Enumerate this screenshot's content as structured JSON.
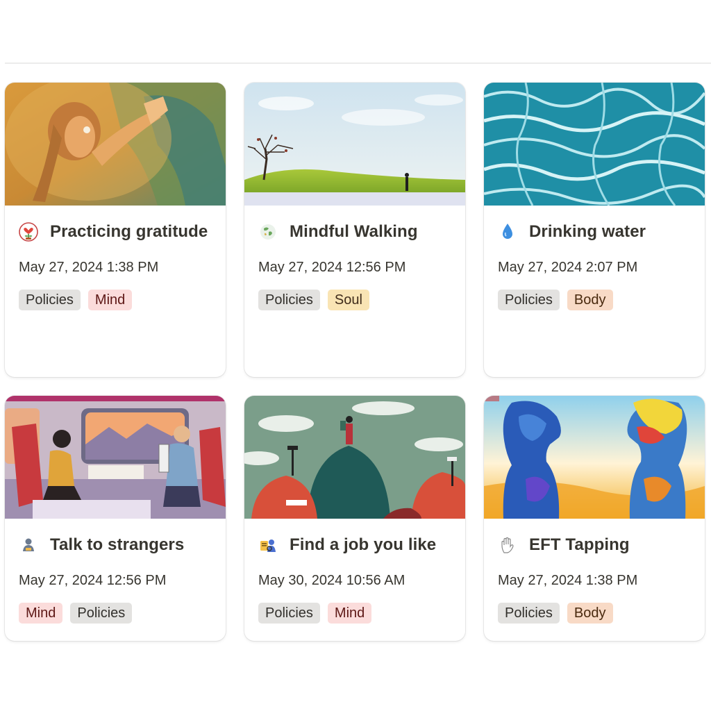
{
  "cards": [
    {
      "title": "Practicing gratitude",
      "date": "May 27, 2024 1:38 PM",
      "icon": "heart-plant-icon",
      "cover": "woman-praying-painting",
      "tags": [
        {
          "label": "Policies",
          "bg": "#e3e2e0",
          "fg": "#32302c"
        },
        {
          "label": "Mind",
          "bg": "#fbdcdb",
          "fg": "#5d1715"
        }
      ]
    },
    {
      "title": "Mindful Walking",
      "date": "May 27, 2024 12:56 PM",
      "icon": "earth-icon",
      "cover": "tree-on-green-hill",
      "tags": [
        {
          "label": "Policies",
          "bg": "#e3e2e0",
          "fg": "#32302c"
        },
        {
          "label": "Soul",
          "bg": "#f9e4b4",
          "fg": "#402c1b"
        }
      ]
    },
    {
      "title": "Drinking water",
      "date": "May 27, 2024 2:07 PM",
      "icon": "water-drop-icon",
      "cover": "pool-water-ripples",
      "tags": [
        {
          "label": "Policies",
          "bg": "#e3e2e0",
          "fg": "#32302c"
        },
        {
          "label": "Body",
          "bg": "#f8dac6",
          "fg": "#49290e"
        }
      ]
    },
    {
      "title": "Talk to strangers",
      "date": "May 27, 2024 12:56 PM",
      "icon": "people-icon",
      "cover": "train-passengers-illustration",
      "tags": [
        {
          "label": "Mind",
          "bg": "#fbdcdb",
          "fg": "#5d1715"
        },
        {
          "label": "Policies",
          "bg": "#e3e2e0",
          "fg": "#32302c"
        }
      ]
    },
    {
      "title": "Find a job you like",
      "date": "May 30, 2024 10:56 AM",
      "icon": "search-job-icon",
      "cover": "hiker-on-hills-illustration",
      "tags": [
        {
          "label": "Policies",
          "bg": "#e3e2e0",
          "fg": "#32302c"
        },
        {
          "label": "Mind",
          "bg": "#fbdcdb",
          "fg": "#5d1715"
        }
      ]
    },
    {
      "title": "EFT Tapping",
      "date": "May 27, 2024 1:38 PM",
      "icon": "hand-tapping-icon",
      "cover": "watercolor-heads",
      "tags": [
        {
          "label": "Policies",
          "bg": "#e3e2e0",
          "fg": "#32302c"
        },
        {
          "label": "Body",
          "bg": "#f8dac6",
          "fg": "#49290e"
        }
      ]
    }
  ]
}
